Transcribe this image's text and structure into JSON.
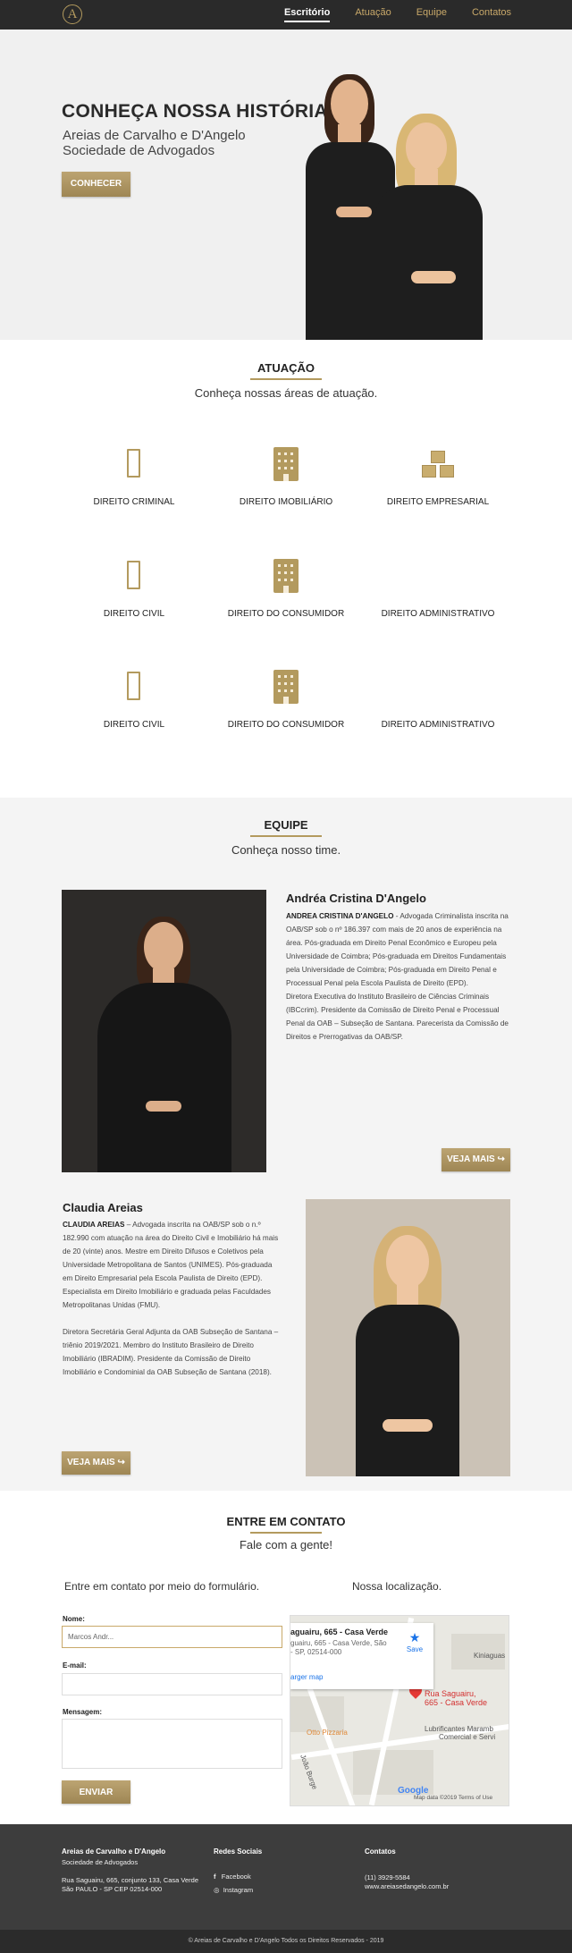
{
  "nav": {
    "logo_letter": "A",
    "links": [
      "Escritório",
      "Atuação",
      "Equipe",
      "Contatos"
    ]
  },
  "hero": {
    "title": "CONHEÇA NOSSA HISTÓRIA",
    "subtitle_line1": "Areias de Carvalho e D'Angelo",
    "subtitle_line2": "Sociedade de Advogados",
    "button": "CONHECER"
  },
  "atuacao": {
    "title": "ATUAÇÃO",
    "subtitle": "Conheça nossas áreas de atuação.",
    "items": [
      {
        "label": "DIREITO CRIMINAL",
        "icon": "book-icon"
      },
      {
        "label": "DIREITO IMOBILIÁRIO",
        "icon": "building-icon"
      },
      {
        "label": "DIREITO EMPRESARIAL",
        "icon": "boxes-icon"
      },
      {
        "label": "DIREITO CIVIL",
        "icon": "book-icon"
      },
      {
        "label": "DIREITO DO CONSUMIDOR",
        "icon": "building-icon"
      },
      {
        "label": "DIREITO ADMINISTRATIVO",
        "icon": "boxes-icon"
      },
      {
        "label": "DIREITO CIVIL",
        "icon": "book-icon"
      },
      {
        "label": "DIREITO DO CONSUMIDOR",
        "icon": "building-icon"
      },
      {
        "label": "DIREITO ADMINISTRATIVO",
        "icon": "boxes-icon"
      }
    ]
  },
  "equipe": {
    "title": "EQUIPE",
    "subtitle": "Conheça nosso time.",
    "members": [
      {
        "name": "Andréa Cristina D'Angelo",
        "bold": "ANDREA CRISTINA D'ANGELO",
        "text": " - Advogada Criminalista inscrita na OAB/SP sob o nº 186.397 com mais de 20 anos de experiência na área. Pós-graduada em Direito Penal Econômico e Europeu pela Universidade de Coimbra; Pós-graduada em Direitos Fundamentais pela Universidade de Coimbra; Pós-graduada em Direito Penal e Processual Penal pela Escola Paulista de Direito (EPD).",
        "text2": "Diretora Executiva do Instituto Brasileiro de Ciências Criminais (IBCcrim). Presidente da Comissão de Direito Penal e Processual Penal da OAB – Subseção de Santana. Parecerista da Comissão de Direitos e Prerrogativas da OAB/SP.",
        "button": "VEJA MAIS"
      },
      {
        "name": "Claudia Areias",
        "bold": "CLAUDIA AREIAS",
        "text": " – Advogada inscrita na OAB/SP sob o n.º 182.990 com atuação na área do Direito Civil e Imobiliário há mais de 20 (vinte) anos. Mestre em Direito Difusos e Coletivos pela Universidade Metropolitana de Santos (UNIMES). Pós-graduada em Direito Empresarial pela Escola Paulista de Direito (EPD). Especialista em Direito Imobiliário e graduada pelas Faculdades Metropolitanas Unidas (FMU).",
        "text2": "Diretora Secretária Geral Adjunta da OAB Subseção de Santana – triênio 2019/2021. Membro do Instituto Brasileiro de Direito Imobiliário (IBRADIM). Presidente da Comissão de Direito Imobiliário e Condominial da OAB Subseção de Santana (2018).",
        "button": "VEJA MAIS"
      }
    ]
  },
  "contato": {
    "title": "ENTRE EM CONTATO",
    "subtitle": "Fale com a gente!",
    "form_heading": "Entre em contato por meio do formulário.",
    "map_heading": "Nossa localização.",
    "name_label": "Nome:",
    "name_value": "Marcos Andr...",
    "email_label": "E-mail:",
    "message_label": "Mensagem:",
    "submit": "ENVIAR"
  },
  "map": {
    "card_title": "aguairu, 665 - Casa Verde",
    "card_address": "guairu, 665 - Casa Verde, São - SP, 02514-000",
    "card_link": "arger map",
    "save": "Save",
    "pin_label_1": "Rua Saguairu,",
    "pin_label_2": "665 - Casa Verde",
    "place1": "Kiniaguas",
    "place2": "Otto Pizzaria",
    "place3": "Lubrificantes Maramb",
    "place4": "Comercial e Servi",
    "street": "João Burge",
    "google": "Google",
    "copyright": "Map data ©2019   Terms of Use"
  },
  "footer": {
    "company": "Areias de Carvalho e D'Angelo",
    "company_sub": "Sociedade de Advogados",
    "address1": "Rua Saguairu, 665, conjunto 133, Casa Verde",
    "address2": "São PAULO - SP CEP 02514-000",
    "social_title": "Redes Sociais",
    "facebook": "Facebook",
    "instagram": "Instagram",
    "contacts_title": "Contatos",
    "phone": "(11) 3929-5584",
    "site": "www.areiasedangelo.com.br",
    "copyright": "© Areias de Carvalho e D'Angelo Todos os Direitos Reservados - 2019"
  },
  "colors": {
    "gold": "#b39a5e",
    "dark": "#2a2a2a"
  }
}
